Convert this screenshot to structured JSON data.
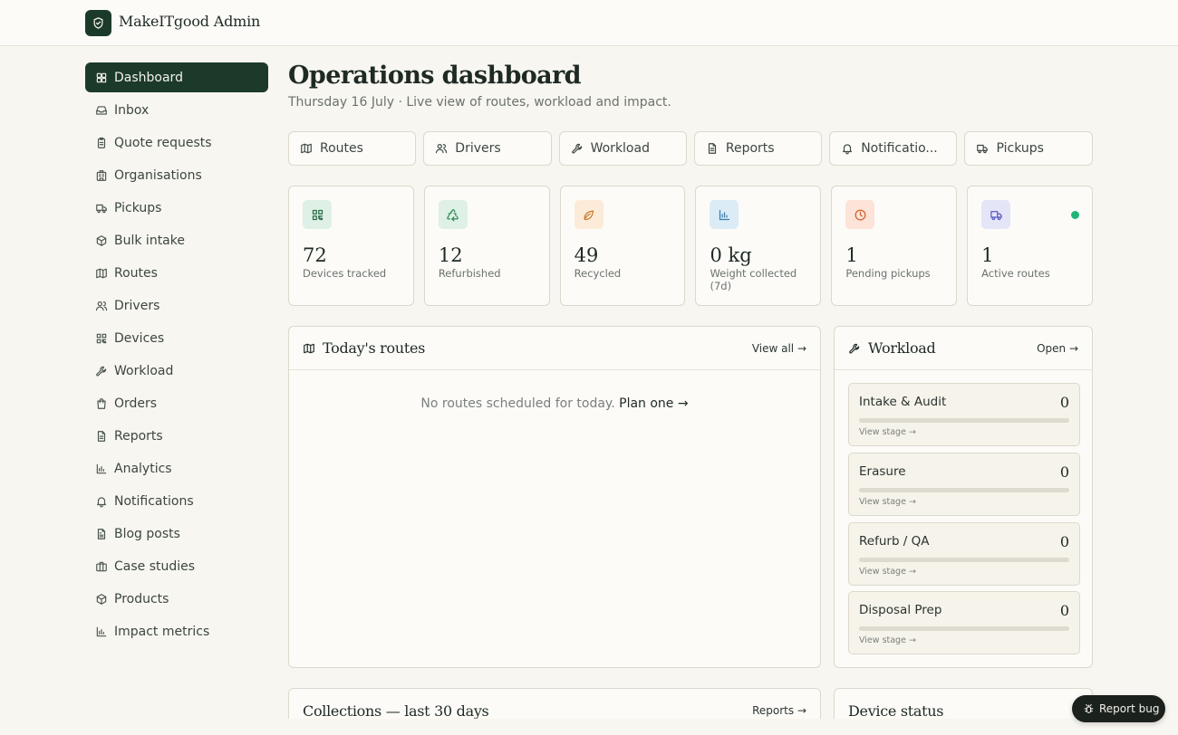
{
  "app": {
    "brand": "MakeITgood Admin"
  },
  "sidebar": {
    "items": [
      {
        "label": "Dashboard",
        "icon": "dashboard-icon",
        "active": true
      },
      {
        "label": "Inbox",
        "icon": "inbox-icon"
      },
      {
        "label": "Quote requests",
        "icon": "clipboard-icon"
      },
      {
        "label": "Organisations",
        "icon": "building-icon"
      },
      {
        "label": "Pickups",
        "icon": "truck-icon"
      },
      {
        "label": "Bulk intake",
        "icon": "package-icon"
      },
      {
        "label": "Routes",
        "icon": "map-icon"
      },
      {
        "label": "Drivers",
        "icon": "users-icon"
      },
      {
        "label": "Devices",
        "icon": "qr-icon"
      },
      {
        "label": "Workload",
        "icon": "wrench-icon"
      },
      {
        "label": "Orders",
        "icon": "bag-icon"
      },
      {
        "label": "Reports",
        "icon": "file-icon"
      },
      {
        "label": "Analytics",
        "icon": "bar-chart-icon"
      },
      {
        "label": "Notifications",
        "icon": "bell-icon"
      },
      {
        "label": "Blog posts",
        "icon": "file-text-icon"
      },
      {
        "label": "Case studies",
        "icon": "briefcase-icon"
      },
      {
        "label": "Products",
        "icon": "package-icon"
      },
      {
        "label": "Impact metrics",
        "icon": "bar-chart-icon"
      }
    ]
  },
  "header": {
    "title": "Operations dashboard",
    "subtitle": "Thursday 16 July · Live view of routes, workload and impact."
  },
  "quick_links": [
    {
      "label": "Routes",
      "icon": "map-icon"
    },
    {
      "label": "Drivers",
      "icon": "users-icon"
    },
    {
      "label": "Workload",
      "icon": "wrench-icon"
    },
    {
      "label": "Reports",
      "icon": "file-icon"
    },
    {
      "label": "Notificatio...",
      "icon": "bell-icon"
    },
    {
      "label": "Pickups",
      "icon": "truck-icon"
    }
  ],
  "stats": [
    {
      "value": "72",
      "label": "Devices tracked",
      "icon": "qr-icon",
      "tile_color": "#dff0e6",
      "icon_color": "#2f6b4a"
    },
    {
      "value": "12",
      "label": "Refurbished",
      "icon": "recycle-icon",
      "tile_color": "#dff0e6",
      "icon_color": "#2f8a55"
    },
    {
      "value": "49",
      "label": "Recycled",
      "icon": "leaf-icon",
      "tile_color": "#fcebd8",
      "icon_color": "#c9792b"
    },
    {
      "value": "0 kg",
      "label": "Weight collected (7d)",
      "icon": "bar-chart-icon",
      "tile_color": "#dcecf6",
      "icon_color": "#3a7fae"
    },
    {
      "value": "1",
      "label": "Pending pickups",
      "icon": "clock-icon",
      "tile_color": "#fde3d8",
      "icon_color": "#d2602d"
    },
    {
      "value": "1",
      "label": "Active routes",
      "icon": "truck-icon",
      "tile_color": "#e5e5f8",
      "icon_color": "#5b5bbf",
      "status_dot": true
    }
  ],
  "routes_panel": {
    "title": "Today's routes",
    "link": "View all →",
    "empty_text": "No routes scheduled for today.",
    "plan_link": "Plan one →"
  },
  "workload_panel": {
    "title": "Workload",
    "link": "Open →",
    "stages": [
      {
        "name": "Intake & Audit",
        "count": "0",
        "progress": 0,
        "view": "View stage →"
      },
      {
        "name": "Erasure",
        "count": "0",
        "progress": 0,
        "view": "View stage →"
      },
      {
        "name": "Refurb / QA",
        "count": "0",
        "progress": 0,
        "view": "View stage →"
      },
      {
        "name": "Disposal Prep",
        "count": "0",
        "progress": 0,
        "view": "View stage →"
      }
    ]
  },
  "collections_panel": {
    "title": "Collections — last 30 days",
    "link": "Reports →"
  },
  "device_panel": {
    "title": "Device status"
  },
  "report_bug": {
    "label": "Report bug"
  }
}
